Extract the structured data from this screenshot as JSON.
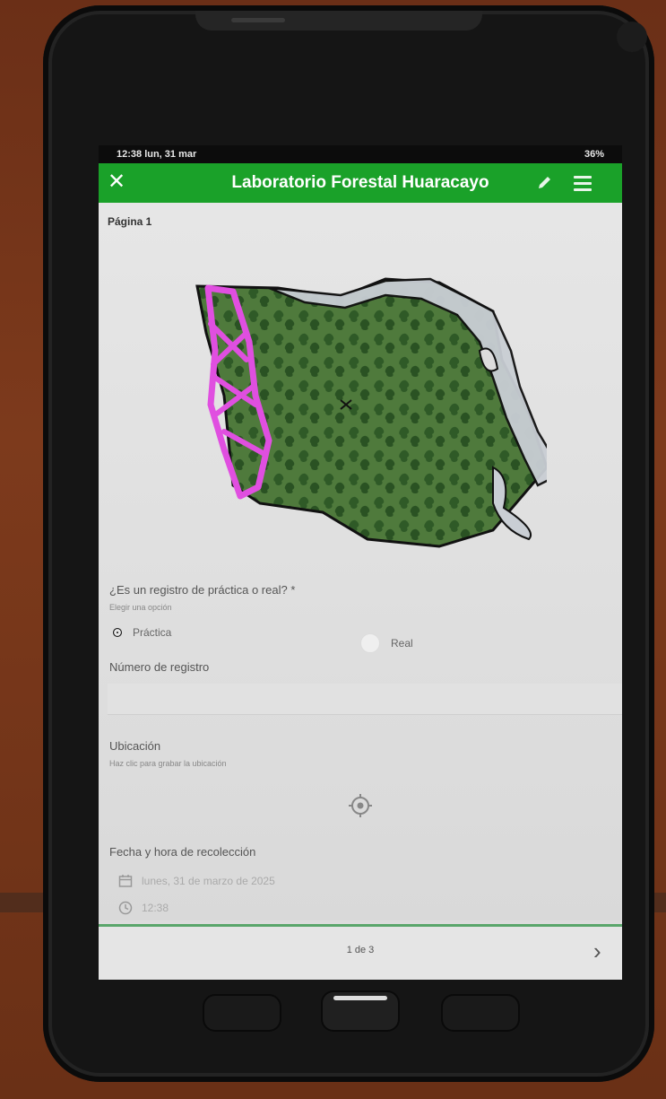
{
  "status_bar": {
    "time_date": "12:38 lun, 31 mar",
    "battery": "36%"
  },
  "header": {
    "title": "Laboratorio Forestal Huaracayo"
  },
  "form": {
    "page_label": "Página 1",
    "question_type": {
      "label": "¿Es un registro de práctica o real? *",
      "hint": "Elegir una opción",
      "options": [
        {
          "label": "Práctica",
          "selected": true
        },
        {
          "label": "Real",
          "selected": false
        }
      ]
    },
    "record_number": {
      "label": "Número de registro",
      "value": ""
    },
    "location": {
      "label": "Ubicación",
      "hint": "Haz clic para grabar la ubicación"
    },
    "datetime": {
      "label": "Fecha y hora de recolección",
      "date_value": "lunes, 31 de marzo de 2025",
      "time_value": "12:38"
    }
  },
  "footer": {
    "page_counter": "1 de 3"
  },
  "colors": {
    "accent": "#1aa129",
    "forest": "#4f7a3c",
    "river": "#c9ced4",
    "boundary": "#e04fe0"
  }
}
